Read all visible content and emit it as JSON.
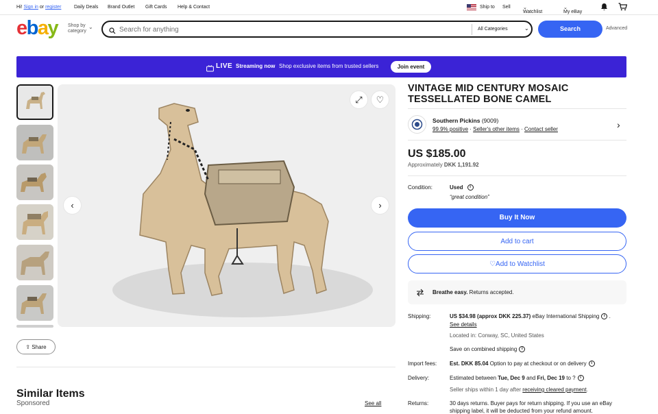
{
  "topbar": {
    "greeting": "Hi!",
    "sign_in": "Sign in",
    "or": "or",
    "register": "register",
    "daily_deals": "Daily Deals",
    "brand_outlet": "Brand Outlet",
    "gift_cards": "Gift Cards",
    "help_contact": "Help & Contact",
    "ship_to": "Ship to",
    "sell": "Sell",
    "watchlist": "Watchlist",
    "my_ebay": "My eBay"
  },
  "header": {
    "logo": [
      "e",
      "b",
      "a",
      "y"
    ],
    "shop_by_1": "Shop by",
    "shop_by_2": "category",
    "search_placeholder": "Search for anything",
    "category": "All Categories",
    "search_button": "Search",
    "advanced": "Advanced"
  },
  "banner": {
    "live": "LIVE",
    "streaming": "Streaming now",
    "text": "Shop exclusive items from trusted sellers",
    "join": "Join event"
  },
  "gallery": {
    "share": "Share"
  },
  "similar": {
    "title": "Similar Items",
    "sponsored": "Sponsored",
    "see_all": "See all"
  },
  "listing": {
    "title": "VINTAGE MID CENTURY MOSAIC TESSELLATED BONE CAMEL",
    "seller_name": "Southern Pickins",
    "seller_score": "(9009)",
    "positive": "99.9% positive",
    "other_items": "Seller's other items",
    "contact": "Contact seller",
    "price": "US $185.00",
    "approx_label": "Approximately",
    "approx_value": "DKK 1,191.92",
    "condition_label": "Condition:",
    "condition": "Used",
    "condition_note": "great condition",
    "buy_now": "Buy It Now",
    "add_cart": "Add to cart",
    "add_watchlist": "Add to Watchlist",
    "breathe": "Breathe easy.",
    "returns_accepted": "Returns accepted.",
    "shipping_label": "Shipping:",
    "shipping_cost": "US $34.98 (approx DKK 225.37)",
    "shipping_method": "eBay International Shipping",
    "see_details": "See details",
    "located": "Located in: Conway, SC, United States",
    "save_combined": "Save on combined shipping",
    "import_label": "Import fees:",
    "import_fee": "Est. DKK 85.04",
    "import_text": "Option to pay at checkout or on delivery",
    "delivery_label": "Delivery:",
    "delivery_text_1": "Estimated between",
    "delivery_date_1": "Tue, Dec 9",
    "delivery_and": "and",
    "delivery_date_2": "Fri, Dec 19",
    "delivery_to": "to ?",
    "handling": "Seller ships within 1 day after",
    "cleared": "receiving cleared payment",
    "returns_label": "Returns:",
    "returns_text_1": "30 days returns. Buyer pays for return shipping. If you use an eBay",
    "returns_text_2": "shipping label, it will be deducted from your refund amount."
  }
}
